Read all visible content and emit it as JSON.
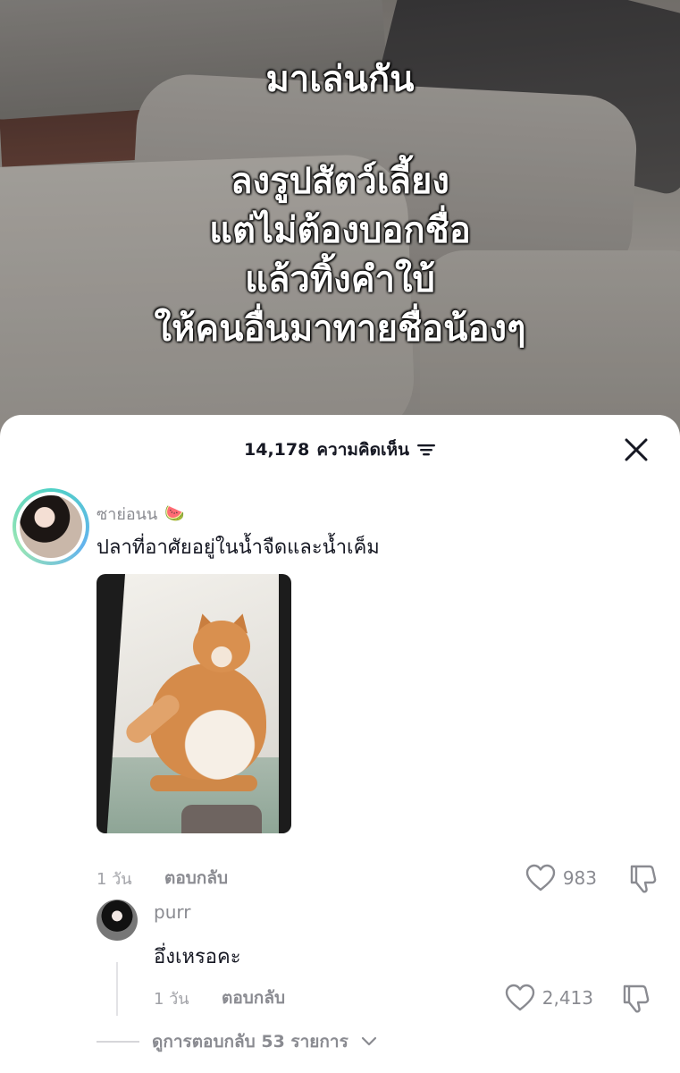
{
  "video": {
    "title": "มาเล่นกัน",
    "lines": [
      "ลงรูปสัตว์เลี้ยง",
      "แต่ไม่ต้องบอกชื่อ",
      "แล้วทิ้งคำใบ้",
      "ให้คนอื่นมาทายชื่อน้องๆ"
    ]
  },
  "comments_sheet": {
    "count": "14,178",
    "label": "ความคิดเห็น",
    "icons": {
      "filter": "filter-icon",
      "close": "close-icon"
    }
  },
  "comment": {
    "username": "ซาย่อนน",
    "username_emoji": "🍉",
    "text": "ปลาที่อาศัยอยู่ในน้ำจืดและน้ำเค็ม",
    "time": "1 วัน",
    "reply_label": "ตอบกลับ",
    "likes": "983"
  },
  "reply": {
    "username": "purr",
    "text": "อึ่งเหรอคะ",
    "time": "1 วัน",
    "reply_label": "ตอบกลับ",
    "likes": "2,413"
  },
  "view_replies": "ดูการตอบกลับ 53 รายการ",
  "colors": {
    "text_primary": "#161823",
    "text_secondary": "#8a8b91",
    "ring": "#4fd1c5"
  }
}
